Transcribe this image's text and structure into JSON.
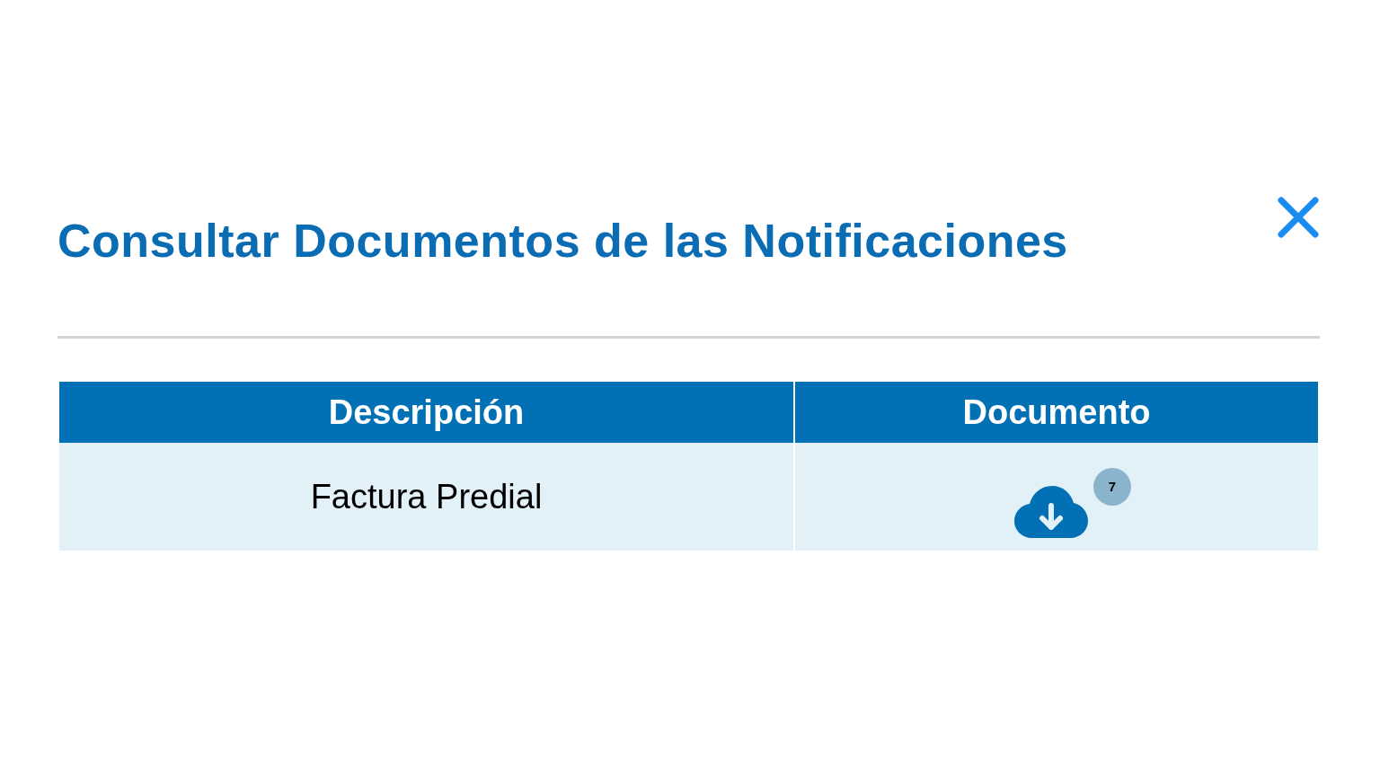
{
  "dialog": {
    "title": "Consultar Documentos de las Notificaciones"
  },
  "table": {
    "columns": [
      "Descripción",
      "Documento"
    ],
    "rows": [
      {
        "description": "Factura Predial",
        "badge": "7"
      }
    ]
  }
}
